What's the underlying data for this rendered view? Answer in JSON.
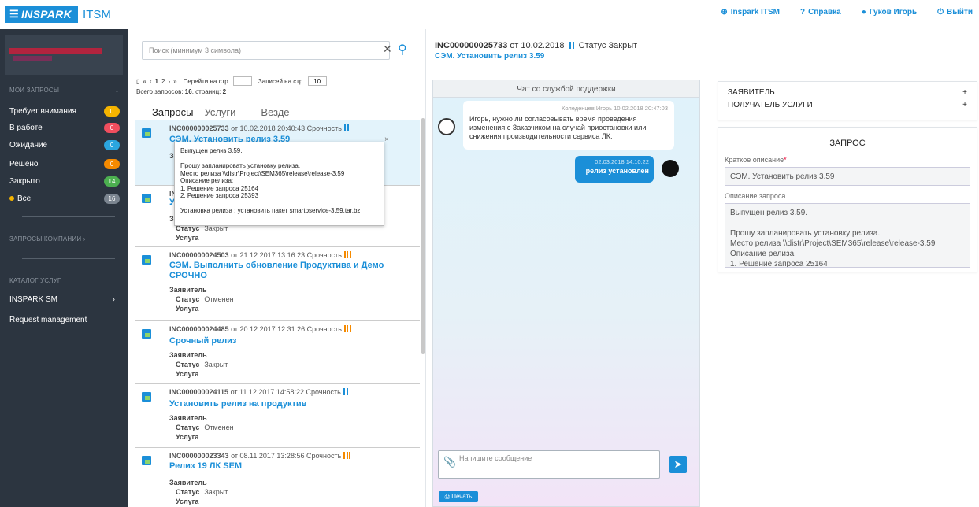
{
  "topbar": {
    "brand": "INSPARK",
    "product": "ITSM",
    "nav": [
      {
        "icon": "globe-icon",
        "label": "Inspark ITSM"
      },
      {
        "icon": "help-icon",
        "label": "Справка"
      },
      {
        "icon": "user-icon",
        "label": "Гуков Игорь"
      },
      {
        "icon": "power-icon",
        "label": "Выйти"
      }
    ]
  },
  "sidebar": {
    "section_my": "МОИ ЗАПРОСЫ",
    "items": [
      {
        "label": "Требует внимания",
        "count": "0",
        "color": "#f5b400"
      },
      {
        "label": "В работе",
        "count": "0",
        "color": "#f04e5e"
      },
      {
        "label": "Ожидание",
        "count": "0",
        "color": "#2ba6e0"
      },
      {
        "label": "Решено",
        "count": "0",
        "color": "#f58a00"
      },
      {
        "label": "Закрыто",
        "count": "14",
        "color": "#4cb050"
      },
      {
        "label": "Все",
        "count": "16",
        "color": "#7b8590"
      }
    ],
    "section_company": "ЗАПРОСЫ КОМПАНИИ",
    "section_catalog": "КАТАЛОГ УСЛУГ",
    "catalog_items": [
      "INSPARK SM",
      "Request management"
    ]
  },
  "list": {
    "search_placeholder": "Поиск (минимум 3 символа)",
    "pager": {
      "pages": [
        "«",
        "‹",
        "1",
        "2",
        "›",
        "»"
      ],
      "goto_label": "Перейти на стр.",
      "per_page_label": "Записей на стр.",
      "per_page_value": "10"
    },
    "totals_label": "Всего запросов: ",
    "totals_count": "16",
    "pages_label": ", страниц: ",
    "pages_count": "2",
    "tabs": [
      "Запросы",
      "Услуги",
      "Везде"
    ],
    "labels": {
      "urgency": "Срочность",
      "applicant": "Заявитель",
      "status": "Статус",
      "service": "Услуга",
      "from": "от"
    },
    "rows": [
      {
        "id": "INC000000025733",
        "date": "10.02.2018 20:40:43",
        "title": "СЭМ. Установить релиз 3.59",
        "status": "Закрыт",
        "priority": "blue"
      },
      {
        "id": "INC000000025",
        "date": "",
        "title": "У",
        "status": "Закрыт",
        "priority": "blue"
      },
      {
        "id": "INC000000024503",
        "date": "21.12.2017 13:16:23",
        "title": "СЭМ. Выполнить обновление Продуктива и Демо СРОЧНО",
        "status": "Отменен",
        "priority": "orange"
      },
      {
        "id": "INC000000024485",
        "date": "20.12.2017 12:31:26",
        "title": "Срочный релиз",
        "status": "Закрыт",
        "priority": "orange"
      },
      {
        "id": "INC000000024115",
        "date": "11.12.2017 14:58:22",
        "title": "Установить релиз на продуктив",
        "status": "Отменен",
        "priority": "blue"
      },
      {
        "id": "INC000000023343",
        "date": "08.11.2017 13:28:56",
        "title": "Релиз 19 ЛК SEM",
        "status": "Закрыт",
        "priority": "orange"
      }
    ],
    "tooltip": "Выпущен релиз 3.59.\n\nПрошу запланировать установку релиза.\nМесто релиза \\\\distr\\Project\\SEM365\\release\\release-3.59\nОписание релиза:\n1. Решение запроса 25164\n2. Решение запроса 25393\n..........\nУстановка релиза : установить пакет smartoservice-3.59.tar.bz"
  },
  "detail": {
    "id": "INC000000025733",
    "from_label": "от",
    "date": "10.02.2018",
    "status_label": "Статус",
    "status": "Закрыт",
    "title": "СЭМ. Установить релиз 3.59"
  },
  "chat": {
    "title": "Чат со службой поддержки",
    "in": {
      "author_time": "Коледенцев Игорь 10.02.2018 20:47:03",
      "text": "Игорь, нужно ли согласовывать время проведения изменения с Заказчиком на случай приостановки или снижения производительности сервиса ЛК."
    },
    "out": {
      "time": "02.03.2018 14:10:22",
      "text": "релиз установлен"
    },
    "input_placeholder": "Напишите сообщение",
    "print_label": "Печать"
  },
  "right": {
    "applicant": "ЗАЯВИТЕЛЬ",
    "recipient": "ПОЛУЧАТЕЛЬ УСЛУГИ",
    "plus": "+",
    "form_title": "ЗАПРОС",
    "short_label": "Краткое описание",
    "short_value": "СЭМ. Установить релиз 3.59",
    "desc_label": "Описание запроса",
    "desc_value": "Выпущен релиз 3.59.\n\nПрошу запланировать установку релиза.\nМесто релиза  \\\\distr\\Project\\SEM365\\release\\release-3.59\nОписание релиза:\n1. Решение запроса 25164"
  }
}
